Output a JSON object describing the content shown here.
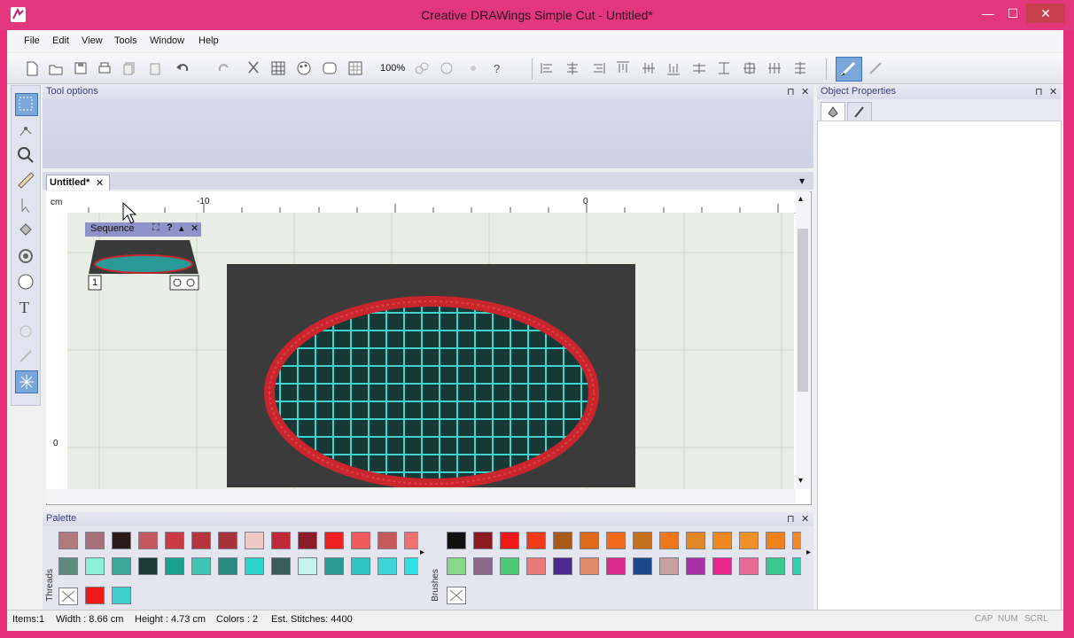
{
  "window": {
    "title": "Creative DRAWings Simple Cut - Untitled*",
    "minimize": "—",
    "maximize": "☐",
    "close": "✕"
  },
  "menu": [
    "File",
    "Edit",
    "View",
    "Tools",
    "Window",
    "Help"
  ],
  "toolbar": {
    "zoom": "100%"
  },
  "tool_options": {
    "title": "Tool options",
    "pin": "⊓",
    "close": "✕"
  },
  "document": {
    "tab_label": "Untitled*",
    "tab_close": "✕",
    "dropdown": "▾"
  },
  "ruler": {
    "unit": "cm",
    "tick_neg10": "-10",
    "tick_0": "0",
    "left_0": "0"
  },
  "sequence": {
    "title": "Sequence",
    "item_number": "1"
  },
  "palette": {
    "title": "Palette",
    "threads_label": "Threads",
    "brushes_label": "Brushes",
    "threads_row1": [
      "#b07a7c",
      "#a8707a",
      "#2a1a1a",
      "#c45a60",
      "#cc3a44",
      "#b8343c",
      "#a8323a",
      "#f0c8c8",
      "#c02838",
      "#8c1c28",
      "#ee2020",
      "#f05a5a",
      "#c85a5a",
      "#f07070"
    ],
    "threads_row2": [
      "#5f8a80",
      "#8cf0d8",
      "#3aa89a",
      "#1a3a36",
      "#1aa08c",
      "#40c4b4",
      "#2a8a80",
      "#2ad4c8",
      "#3a5c58",
      "#c8f4f0",
      "#2a9a94",
      "#30c4c4",
      "#40d4d8",
      "#30e0e4"
    ],
    "threads_row3": [
      "#ffffff",
      "#ee1a1a",
      "#40d0cc"
    ],
    "brushes_row1": [
      "#111111",
      "#8a1a20",
      "#f01818",
      "#f03a18",
      "#a85a18",
      "#e06a1a",
      "#f06a18",
      "#c4701a",
      "#f07818",
      "#e08828",
      "#f08820",
      "#f09028",
      "#f08018",
      "#f08a28"
    ],
    "brushes_row2": [
      "#88d888",
      "#8a6a8a",
      "#50c878",
      "#e87a7a",
      "#4a2a8a",
      "#e08a6a",
      "#d82a8a",
      "#1a4a8a",
      "#c8a0a0",
      "#a830a8",
      "#e82888",
      "#e86a9a",
      "#3ac890",
      "#30d0b0"
    ],
    "brushes_row3": [
      "#ffffff"
    ],
    "scroll_right": "▸"
  },
  "object_properties": {
    "title": "Object Properties",
    "pin": "⊓",
    "close": "✕"
  },
  "status": {
    "items": "Items:1",
    "width": "Width : 8.66 cm",
    "height": "Height : 4.73 cm",
    "colors": "Colors : 2",
    "stitches": "Est. Stitches: 4400",
    "cap": "CAP",
    "num": "NUM",
    "scrl": "SCRL"
  },
  "colors": {
    "title_bar": "#e3377d",
    "hoop": "#3b3b3b",
    "outline": "#c8262c",
    "fill_grid": "#3ed4d2"
  }
}
